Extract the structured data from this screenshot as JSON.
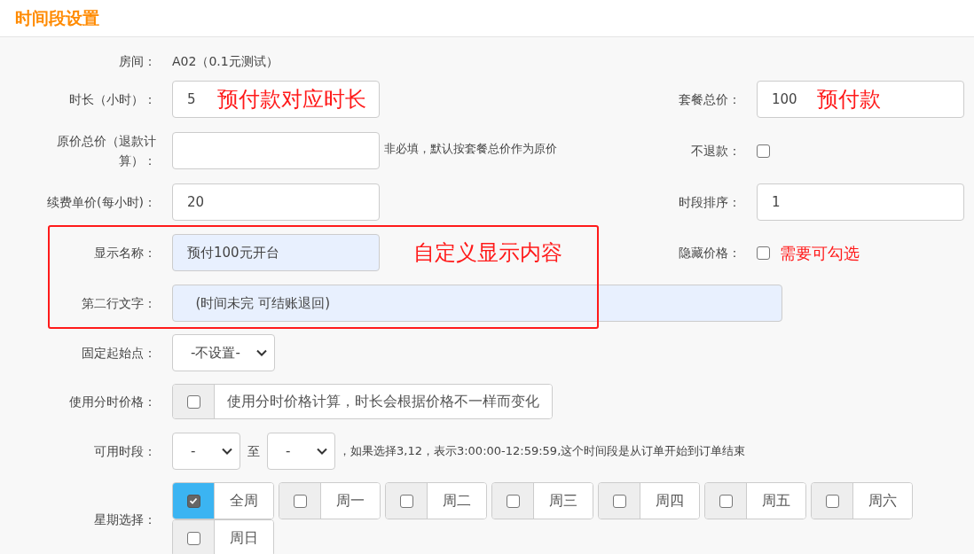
{
  "title": "时间段设置",
  "room": {
    "label": "房间：",
    "value": "A02（0.1元测试）"
  },
  "duration": {
    "label": "时长（小时）：",
    "value": "5",
    "note": "预付款对应时长"
  },
  "package_price": {
    "label": "套餐总价：",
    "value": "100",
    "note": "预付款"
  },
  "original_price": {
    "label": "原价总价（退款计算）：",
    "hint": "非必填，默认按套餐总价作为原价"
  },
  "no_refund": {
    "label": "不退款：",
    "checked": false
  },
  "renew_price": {
    "label": "续费单价(每小时)：",
    "value": "20"
  },
  "sort": {
    "label": "时段排序：",
    "value": "1"
  },
  "display_name": {
    "label": "显示名称：",
    "value": "预付100元开台"
  },
  "custom_note": "自定义显示内容",
  "hide_price": {
    "label": "隐藏价格：",
    "checked": false,
    "note": "需要可勾选"
  },
  "second_line": {
    "label": "第二行文字：",
    "value": "  (时间未完 可结账退回)"
  },
  "fixed_start": {
    "label": "固定起始点：",
    "value": "-不设置-"
  },
  "time_pricing": {
    "label": "使用分时价格：",
    "checked": false,
    "text": "使用分时价格计算，时长会根据价格不一样而变化"
  },
  "available": {
    "label": "可用时段：",
    "from": "-",
    "separator": "至",
    "to": "-",
    "hint": "，如果选择3,12，表示3:00:00-12:59:59,这个时间段是从订单开始到订单结束"
  },
  "weekdays": {
    "label": "星期选择：",
    "days": [
      {
        "label": "全周",
        "checked": true
      },
      {
        "label": "周一",
        "checked": false
      },
      {
        "label": "周二",
        "checked": false
      },
      {
        "label": "周三",
        "checked": false
      },
      {
        "label": "周四",
        "checked": false
      },
      {
        "label": "周五",
        "checked": false
      },
      {
        "label": "周六",
        "checked": false
      },
      {
        "label": "周日",
        "checked": false
      }
    ]
  }
}
